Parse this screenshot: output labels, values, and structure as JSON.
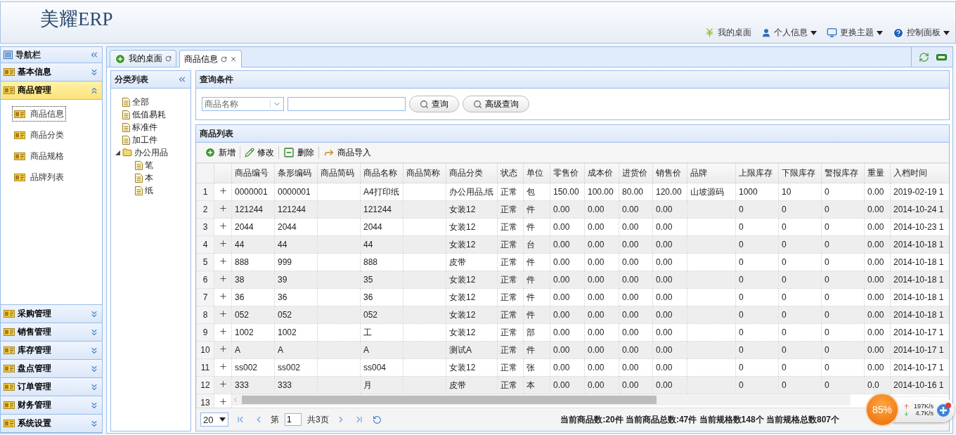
{
  "header": {
    "logo": "美耀ERP",
    "menu": [
      {
        "label": "我的桌面",
        "kind": "yen",
        "menu": false
      },
      {
        "label": "个人信息",
        "kind": "user",
        "menu": true
      },
      {
        "label": "更换主题",
        "kind": "monitor",
        "menu": true
      },
      {
        "label": "控制面板",
        "kind": "help",
        "menu": true
      }
    ]
  },
  "sidebar": {
    "title": "导航栏",
    "panels": [
      {
        "label": "基本信息",
        "expanded": false
      },
      {
        "label": "商品管理",
        "expanded": true,
        "items": [
          {
            "label": "商品信息",
            "selected": true
          },
          {
            "label": "商品分类",
            "selected": false
          },
          {
            "label": "商品规格",
            "selected": false
          },
          {
            "label": "品牌列表",
            "selected": false
          }
        ]
      },
      {
        "label": "采购管理",
        "expanded": false
      },
      {
        "label": "销售管理",
        "expanded": false
      },
      {
        "label": "库存管理",
        "expanded": false
      },
      {
        "label": "盘点管理",
        "expanded": false
      },
      {
        "label": "订单管理",
        "expanded": false
      },
      {
        "label": "财务管理",
        "expanded": false
      },
      {
        "label": "系统设置",
        "expanded": false
      }
    ]
  },
  "tabs": [
    {
      "label": "我的桌面",
      "selected": false,
      "closable": false
    },
    {
      "label": "商品信息",
      "selected": true,
      "closable": true
    }
  ],
  "category_panel": {
    "title": "分类列表",
    "tree": [
      {
        "label": "全部",
        "expanded": false
      },
      {
        "label": "低值易耗",
        "expanded": false
      },
      {
        "label": "标准件",
        "expanded": false
      },
      {
        "label": "加工件",
        "expanded": false
      },
      {
        "label": "办公用品",
        "expanded": true,
        "children": [
          {
            "label": "笔",
            "expanded": false
          },
          {
            "label": "本",
            "expanded": false
          },
          {
            "label": "纸",
            "expanded": false
          }
        ]
      }
    ]
  },
  "query": {
    "title": "查询条件",
    "field_select": "商品名称",
    "buttons": [
      {
        "label": "查询"
      },
      {
        "label": "高级查询"
      }
    ]
  },
  "list": {
    "title": "商品列表",
    "toolbar": [
      {
        "label": "新增",
        "kind": "add"
      },
      {
        "label": "修改",
        "kind": "edit"
      },
      {
        "label": "删除",
        "kind": "delete"
      },
      {
        "label": "商品导入",
        "kind": "import"
      }
    ],
    "columns": [
      "商品编号",
      "条形编码",
      "商品简码",
      "商品名称",
      "商品简称",
      "商品分类",
      "状态",
      "单位",
      "零售价",
      "成本价",
      "进货价",
      "销售价",
      "品牌",
      "上限库存",
      "下限库存",
      "警报库存",
      "重量",
      "入档时间"
    ],
    "rows": [
      {
        "number": "1",
        "cells": [
          "0000001",
          "0000001",
          null,
          "A4打印纸",
          null,
          "办公用品,纸",
          "正常",
          "包",
          "150.00",
          "100.00",
          "80.00",
          "120.00",
          "山坡源码",
          "1000",
          "10",
          "0",
          "0.00",
          "2019-02-19 1"
        ]
      },
      {
        "number": "2",
        "cells": [
          "121244",
          "121244",
          null,
          "121244",
          null,
          "女装12",
          "正常",
          "件",
          "0.00",
          "0.00",
          "0.00",
          "0.00",
          null,
          "0",
          "0",
          "0",
          "0.00",
          "2014-10-24 1"
        ]
      },
      {
        "number": "3",
        "cells": [
          "2044",
          "2044",
          null,
          "2044",
          null,
          "女装12",
          "正常",
          "件",
          "0.00",
          "0.00",
          "0.00",
          "0.00",
          null,
          "0",
          "0",
          "0",
          "0.00",
          "2014-10-23 1"
        ]
      },
      {
        "number": "4",
        "cells": [
          "44",
          "44",
          null,
          "44",
          null,
          "女装12",
          "正常",
          "台",
          "0.00",
          "0.00",
          "0.00",
          "0.00",
          null,
          "0",
          "0",
          "0",
          "0.00",
          "2014-10-18 1"
        ]
      },
      {
        "number": "5",
        "cells": [
          "888",
          "999",
          null,
          "888",
          null,
          "皮带",
          "正常",
          "件",
          "0.00",
          "0.00",
          "0.00",
          "0.00",
          null,
          "0",
          "0",
          "0",
          "0.00",
          "2014-10-18 1"
        ]
      },
      {
        "number": "6",
        "cells": [
          "38",
          "39",
          null,
          "35",
          null,
          "女装12",
          "正常",
          "件",
          "0.00",
          "0.00",
          "0.00",
          "0.00",
          null,
          "0",
          "0",
          "0",
          "0.00",
          "2014-10-18 1"
        ]
      },
      {
        "number": "7",
        "cells": [
          "36",
          "36",
          null,
          "36",
          null,
          "女装12",
          "正常",
          "件",
          "0.00",
          "0.00",
          "0.00",
          "0.00",
          null,
          "0",
          "0",
          "0",
          "0.00",
          "2014-10-18 1"
        ]
      },
      {
        "number": "8",
        "cells": [
          "052",
          "052",
          null,
          "052",
          null,
          "女装12",
          "正常",
          "件",
          "0.00",
          "0.00",
          "0.00",
          "0.00",
          null,
          "0",
          "0",
          "0",
          "0.00",
          "2014-10-18 1"
        ]
      },
      {
        "number": "9",
        "cells": [
          "1002",
          "1002",
          null,
          "工",
          null,
          "女装12",
          "正常",
          "部",
          "0.00",
          "0.00",
          "0.00",
          "0.00",
          null,
          "0",
          "0",
          "0",
          "0.00",
          "2014-10-17 1"
        ]
      },
      {
        "number": "10",
        "cells": [
          "A",
          "A",
          null,
          "A",
          null,
          "测试A",
          "正常",
          "件",
          "0.00",
          "0.00",
          "0.00",
          "0.00",
          null,
          "0",
          "0",
          "0",
          "0.00",
          "2014-10-17 1"
        ]
      },
      {
        "number": "11",
        "cells": [
          "ss002",
          "ss002",
          null,
          "ss004",
          null,
          "女装12",
          "正常",
          "张",
          "0.00",
          "0.00",
          "0.00",
          "0.00",
          null,
          "0",
          "0",
          "0",
          "0.00",
          "2014-10-17 1"
        ]
      },
      {
        "number": "12",
        "cells": [
          "333",
          "333",
          null,
          "月",
          null,
          "皮带",
          "正常",
          "本",
          "0.00",
          "0.00",
          "0.00",
          "0.00",
          null,
          "0",
          "0",
          "0",
          "0.0",
          "2014-10-16 1"
        ]
      },
      {
        "number": "13"
      }
    ],
    "pager": {
      "page_size": "20",
      "page_prefix": "第",
      "page": "1",
      "total_pages": "共3页",
      "summary": "当前商品数:20件 当前商品总数:47件 当前规格数148个 当前规格总数807个"
    }
  },
  "speed_widget": {
    "percent": "85%",
    "upload": "197K/s",
    "download": "4.7K/s"
  }
}
